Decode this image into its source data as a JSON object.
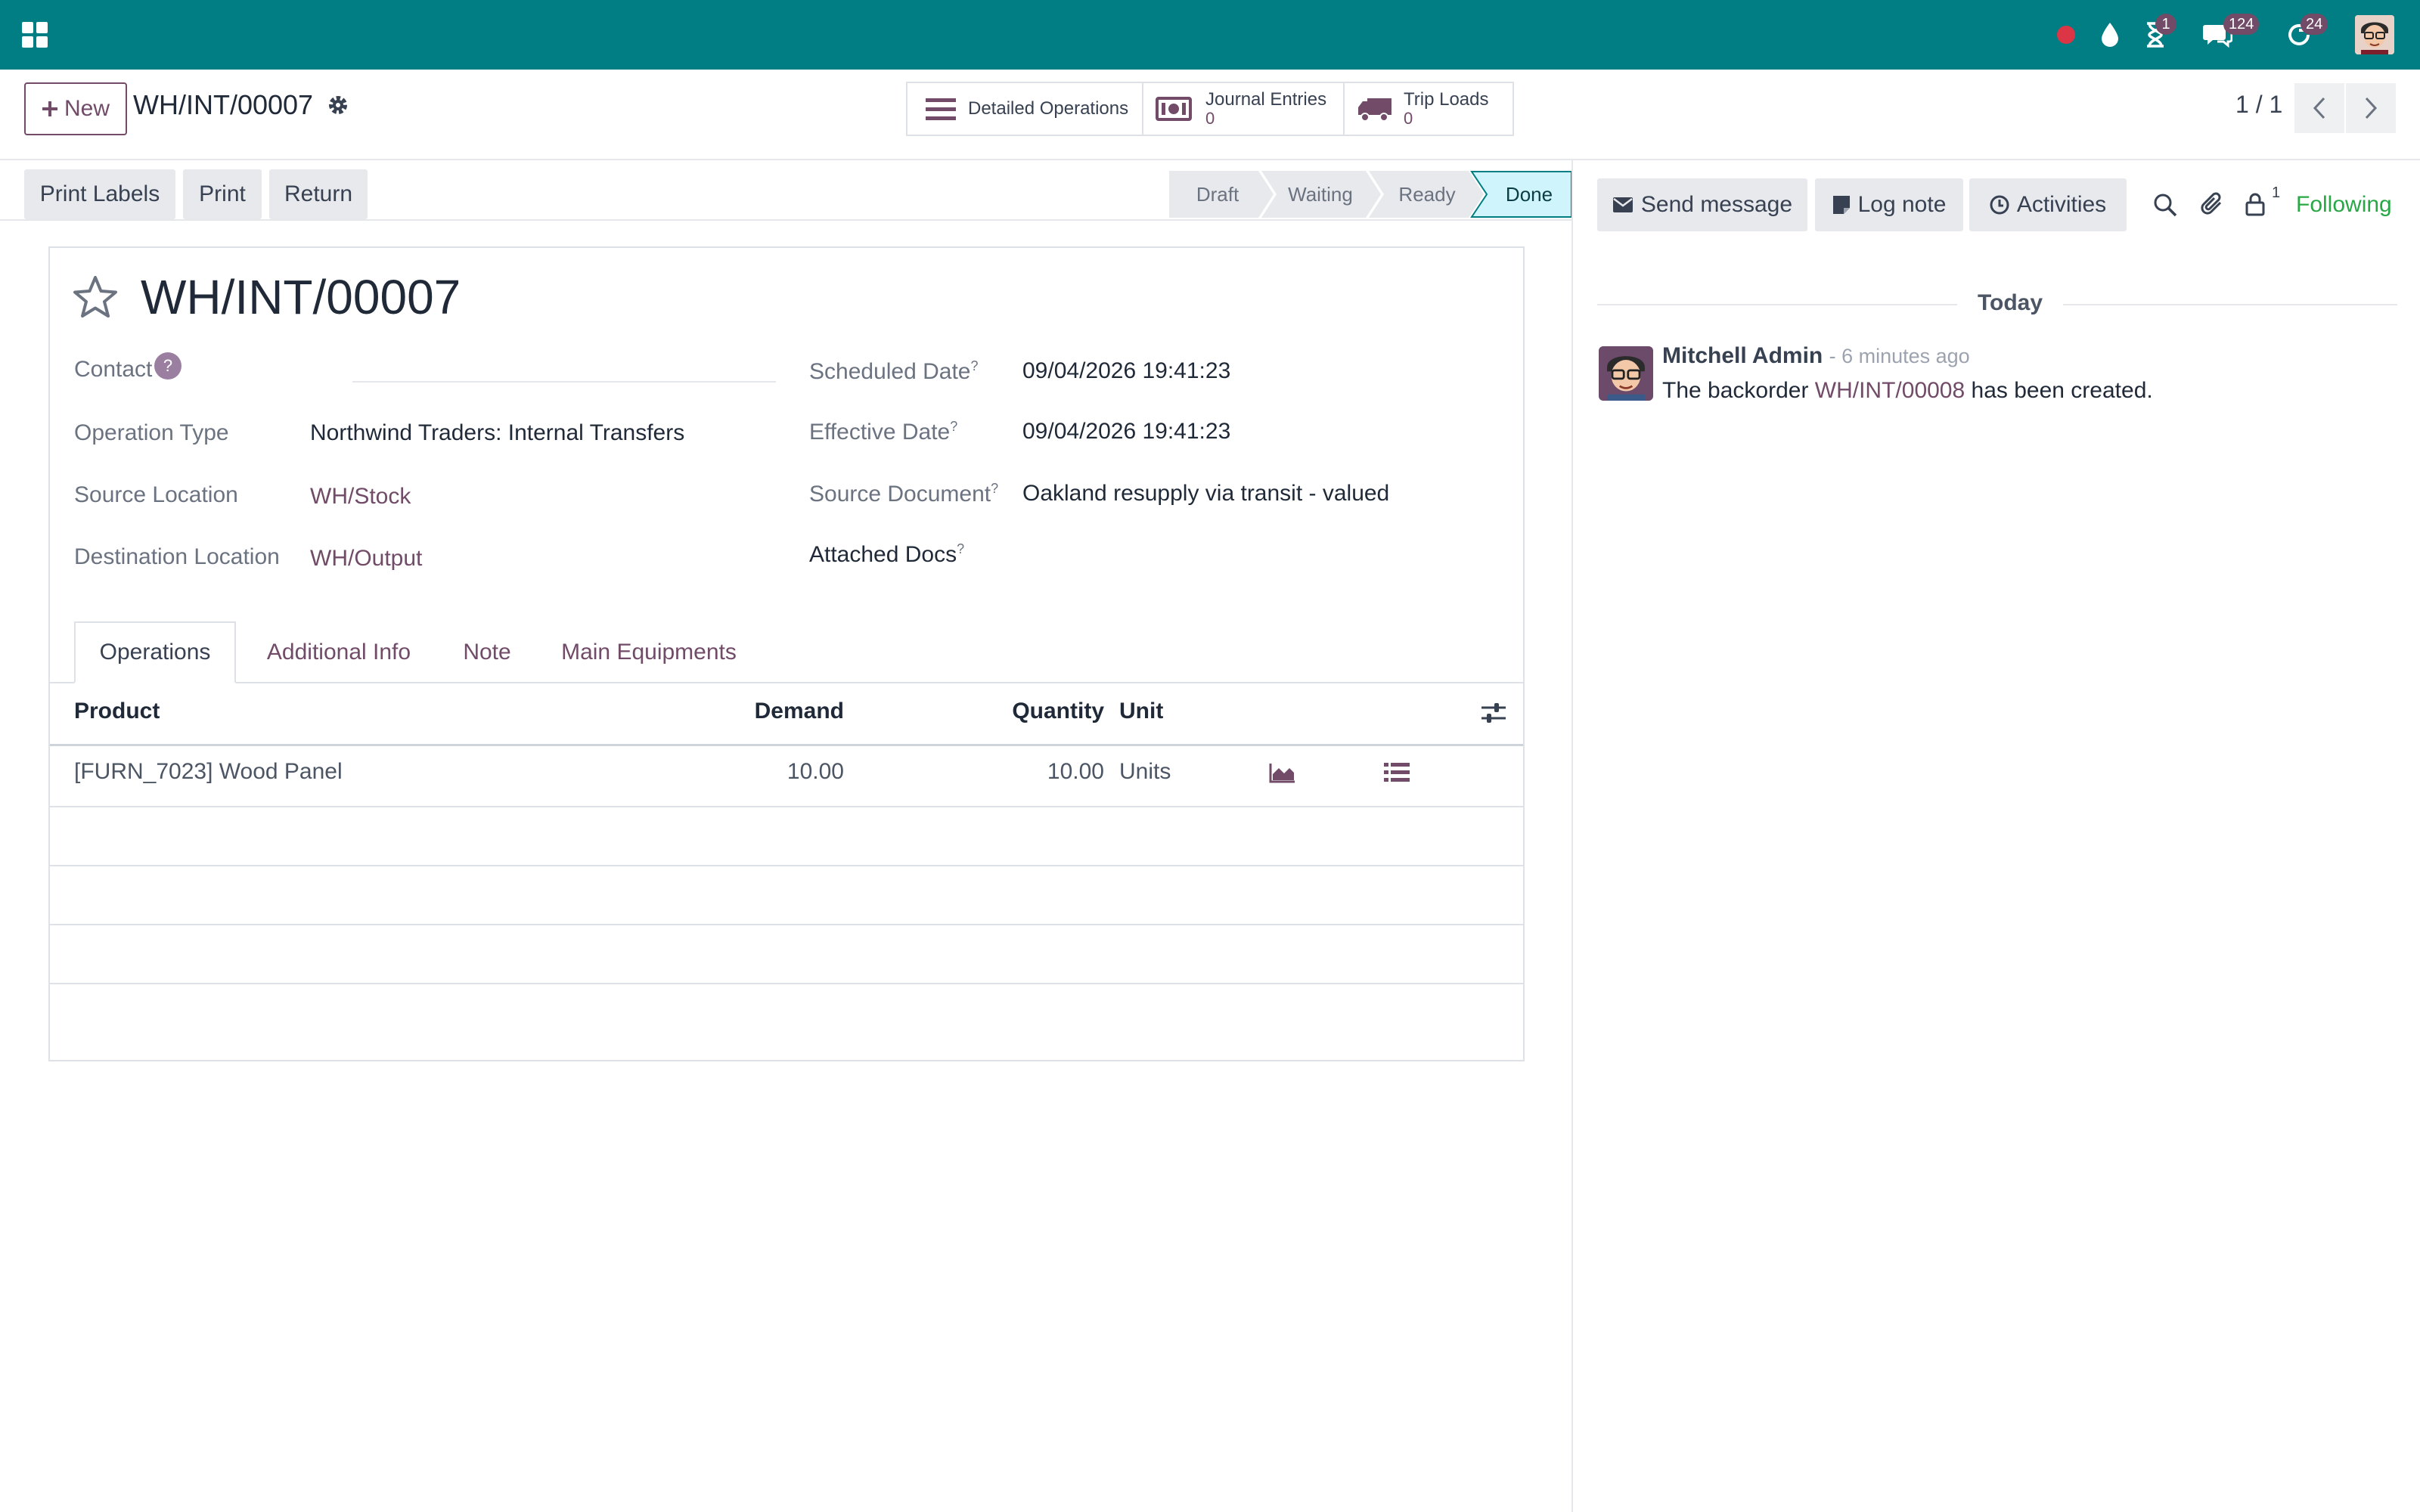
{
  "navbar": {
    "notification_badges": {
      "activities": "1",
      "messages": "124",
      "updates": "24"
    },
    "icons": [
      "apps-grid-icon",
      "record-dot-icon",
      "droplet-icon",
      "hourglass-icon",
      "chat-icon",
      "refresh-icon",
      "user-avatar"
    ]
  },
  "control": {
    "new_label": "New",
    "breadcrumb": "WH/INT/00007",
    "smart_buttons": {
      "detailed_ops": {
        "label": "Detailed Operations"
      },
      "journal": {
        "label": "Journal Entries",
        "count": "0"
      },
      "trip": {
        "label": "Trip Loads",
        "count": "0"
      }
    },
    "pager": "1 / 1"
  },
  "statusbar": {
    "buttons": {
      "print_labels": "Print Labels",
      "print": "Print",
      "return": "Return"
    },
    "stages": {
      "draft": "Draft",
      "waiting": "Waiting",
      "ready": "Ready",
      "done": "Done"
    },
    "current_stage": "Done"
  },
  "form": {
    "title": "WH/INT/00007",
    "labels": {
      "contact": "Contact",
      "operation_type": "Operation Type",
      "source_location": "Source Location",
      "destination_location": "Destination Location",
      "scheduled_date": "Scheduled Date",
      "effective_date": "Effective Date",
      "source_document": "Source Document",
      "attached_docs": "Attached Docs"
    },
    "help_mark": "?",
    "values": {
      "operation_type": "Northwind Traders: Internal Transfers",
      "source_location": "WH/Stock",
      "destination_location": "WH/Output",
      "scheduled_date": "09/04/2026 19:41:23",
      "effective_date": "09/04/2026 19:41:23",
      "source_document": "Oakland resupply via transit - valued"
    },
    "tabs": {
      "operations": "Operations",
      "additional_info": "Additional Info",
      "note": "Note",
      "main_equipments": "Main Equipments"
    }
  },
  "table": {
    "headers": {
      "product": "Product",
      "demand": "Demand",
      "quantity": "Quantity",
      "unit": "Unit"
    },
    "row": {
      "product": "[FURN_7023] Wood Panel",
      "demand": "10.00",
      "quantity": "10.00",
      "unit": "Units"
    }
  },
  "chatter": {
    "buttons": {
      "send_message": "Send message",
      "log_note": "Log note",
      "activities": "Activities"
    },
    "follower_count": "1",
    "following": "Following",
    "date_separator": "Today",
    "message": {
      "author": "Mitchell Admin",
      "time": "- 6 minutes ago",
      "text_before": "The backorder",
      "link": "WH/INT/00008",
      "text_after": "has been created."
    }
  },
  "colors": {
    "navbar": "#017e84",
    "brand": "#714b67",
    "done_stage": "#cff4fc",
    "following": "#28a745"
  }
}
